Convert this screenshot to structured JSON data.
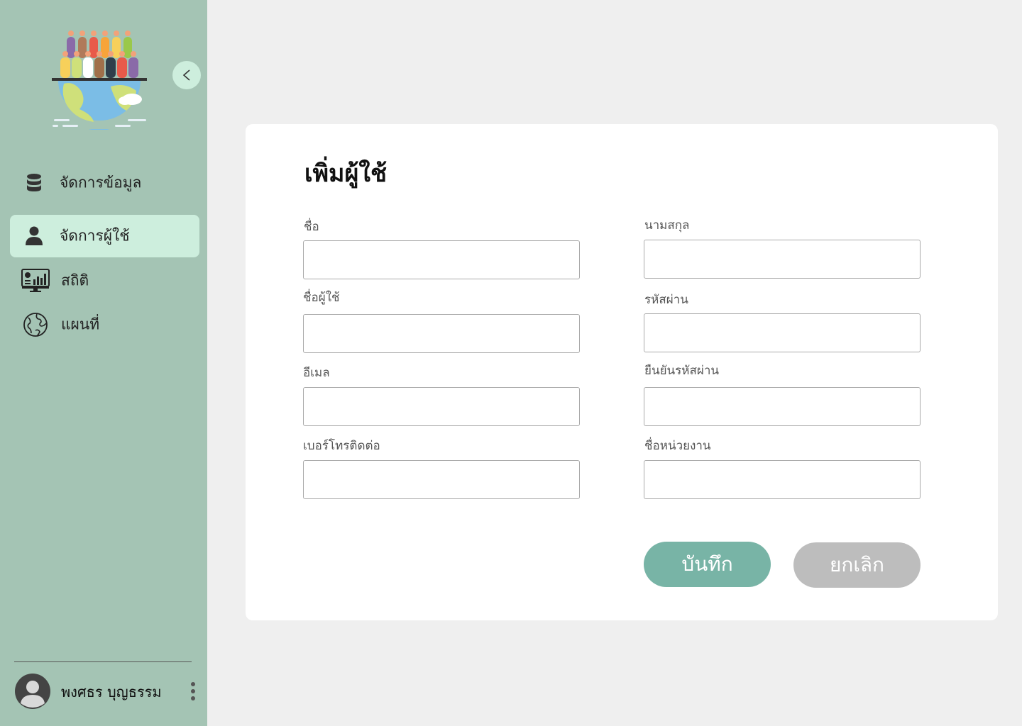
{
  "sidebar": {
    "collapse_glyph": "<",
    "items": [
      {
        "label": "จัดการข้อมูล",
        "icon": "database-icon"
      },
      {
        "label": "จัดการผู้ใช้",
        "icon": "user-icon",
        "active": true
      },
      {
        "label": "สถิติ",
        "icon": "statistics-monitor-icon"
      },
      {
        "label": "แผนที่",
        "icon": "globe-icon"
      }
    ],
    "user": {
      "name": "พงศธร บุญธรรม"
    }
  },
  "form": {
    "title": "เพิ่มผู้ใช้",
    "fields": {
      "first_name": {
        "label": "ชื่อ",
        "value": ""
      },
      "last_name": {
        "label": "นามสกุล",
        "value": ""
      },
      "username": {
        "label": "ชื่อผู้ใช้",
        "value": ""
      },
      "password": {
        "label": "รหัสผ่าน",
        "value": ""
      },
      "email": {
        "label": "อีเมล",
        "value": ""
      },
      "confirm_password": {
        "label": "ยืนยันรหัสผ่าน",
        "value": ""
      },
      "phone": {
        "label": "เบอร์โทรติดต่อ",
        "value": ""
      },
      "department": {
        "label": "ชื่อหน่วยงาน",
        "value": ""
      }
    },
    "save_label": "บันทึก",
    "cancel_label": "ยกเลิก"
  },
  "colors": {
    "sidebar_bg": "#a4c4b4",
    "active_item_bg": "#cdeedd",
    "save_button": "#78b4a6",
    "cancel_button": "#bdbdbd",
    "page_bg": "#efefef"
  }
}
